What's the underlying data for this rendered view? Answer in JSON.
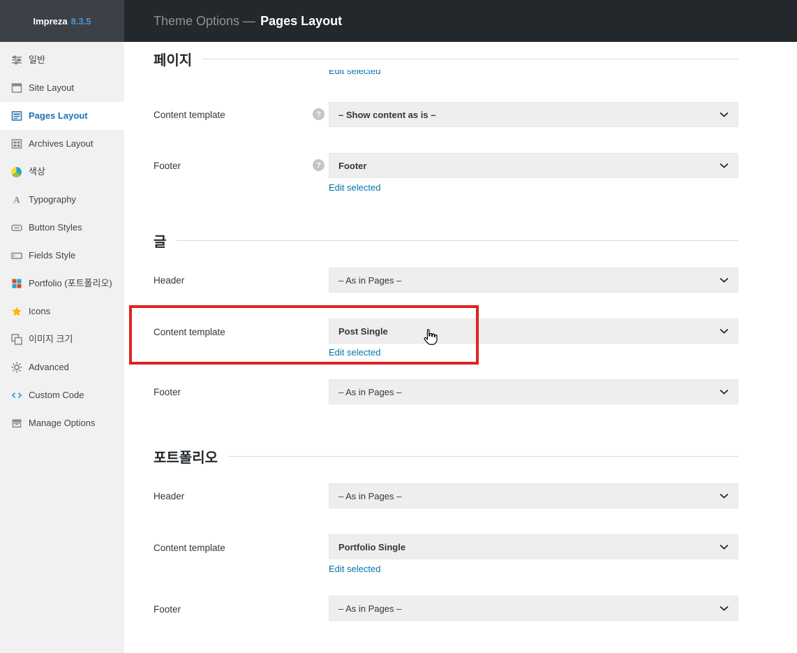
{
  "colors": {
    "accent_blue": "#2271b1",
    "link_blue": "#0073aa",
    "highlight_red": "#e0241f",
    "topbar_bg": "#23282d",
    "sidebar_bg": "#f1f1f1",
    "select_bg": "#eeeeee"
  },
  "icons": {
    "help_glyph": "?"
  },
  "topbar": {
    "brand": "Impreza",
    "version": "8.3.5",
    "title_prefix": "Theme Options —",
    "title": "Pages Layout"
  },
  "sidebar": {
    "active_item": "Pages Layout",
    "items": [
      {
        "label": "일반"
      },
      {
        "label": "Site Layout"
      },
      {
        "label": "Pages Layout"
      },
      {
        "label": "Archives Layout"
      },
      {
        "label": "색상"
      },
      {
        "label": "Typography"
      },
      {
        "label": "Button Styles"
      },
      {
        "label": "Fields Style"
      },
      {
        "label": "Portfolio (포트폴리오)"
      },
      {
        "label": "Icons"
      },
      {
        "label": "이미지 크기"
      },
      {
        "label": "Advanced"
      },
      {
        "label": "Custom Code"
      },
      {
        "label": "Manage Options"
      }
    ]
  },
  "content": {
    "clipped_link": "Edit selected",
    "sections": [
      {
        "title": "페이지",
        "rows": [
          {
            "label": "Content template",
            "value": "– Show content as is –"
          },
          {
            "label": "Footer",
            "value": "Footer",
            "edit_link": "Edit selected"
          }
        ]
      },
      {
        "title": "글",
        "rows": [
          {
            "label": "Header",
            "value": "– As in Pages –"
          },
          {
            "label": "Content template",
            "value": "Post Single",
            "edit_link": "Edit selected"
          },
          {
            "label": "Footer",
            "value": "– As in Pages –"
          }
        ]
      },
      {
        "title": "포트폴리오",
        "rows": [
          {
            "label": "Header",
            "value": "– As in Pages –"
          },
          {
            "label": "Content template",
            "value": "Portfolio Single",
            "edit_link": "Edit selected"
          },
          {
            "label": "Footer",
            "value": "– As in Pages –"
          }
        ]
      }
    ]
  }
}
